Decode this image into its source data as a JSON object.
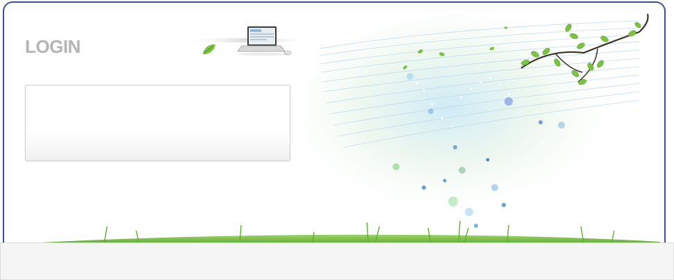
{
  "login": {
    "title": "LOGIN"
  },
  "icons": {
    "laptop": "laptop-icon",
    "leaf": "leaf-icon",
    "branch": "branch-icon"
  },
  "colors": {
    "frame_border": "#3b4f9a",
    "title_text": "#b5b5b5",
    "leaf_green": "#7cc242",
    "grass_green": "#5fae2e",
    "footer_bg": "#f5f5f5"
  }
}
